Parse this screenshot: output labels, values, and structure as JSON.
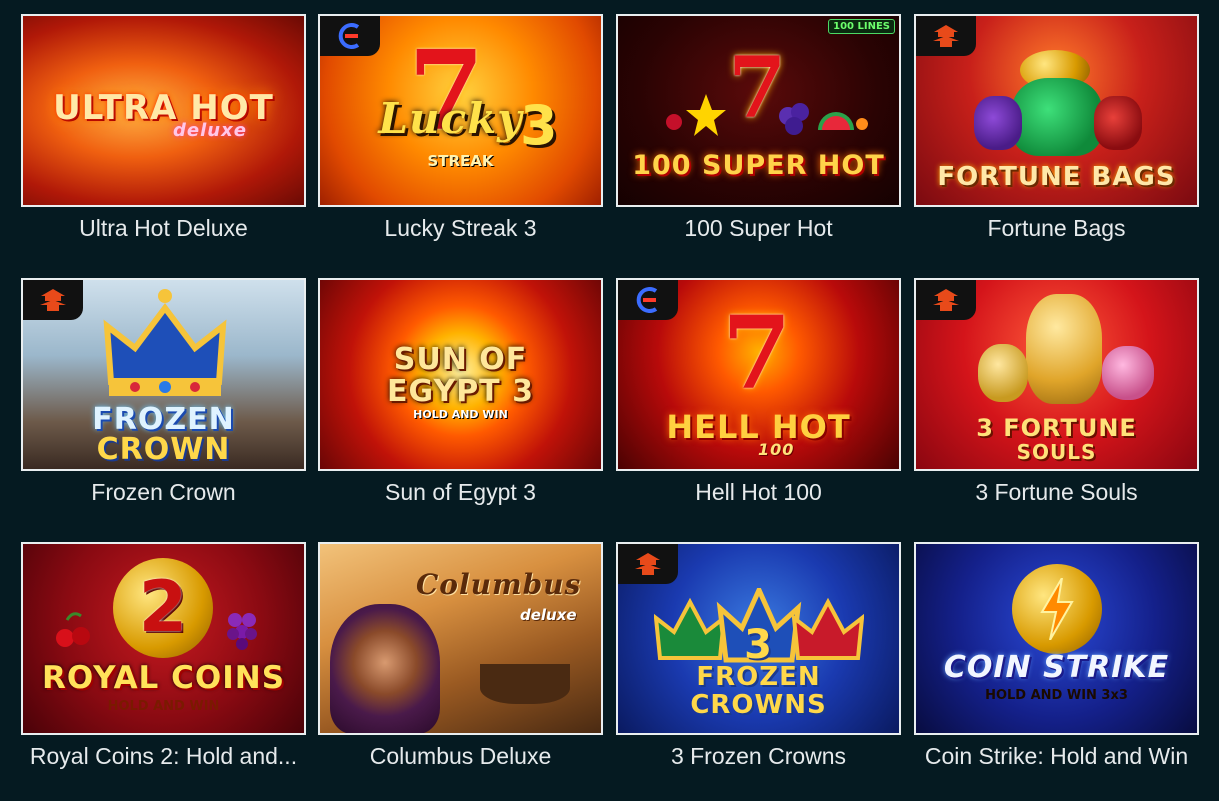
{
  "games": [
    {
      "title": "Ultra Hot Deluxe",
      "art_text": "ULTRA HOT",
      "art_sub": "deluxe"
    },
    {
      "title": "Lucky Streak 3",
      "art_text": "Lucky",
      "art_sub": "STREAK",
      "art_num": "3",
      "art_seven": "7"
    },
    {
      "title": "100 Super Hot",
      "art_text": "100 SUPER HOT",
      "art_badge": "100 LINES",
      "art_seven": "7"
    },
    {
      "title": "Fortune Bags",
      "art_text": "FORTUNE BAGS"
    },
    {
      "title": "Frozen Crown",
      "art_text": "FROZEN",
      "art_sub": "CROWN"
    },
    {
      "title": "Sun of Egypt 3",
      "art_text": "SUN OF EGYPT 3",
      "art_sub": "HOLD AND WIN"
    },
    {
      "title": "Hell Hot 100",
      "art_text": "HELL HOT",
      "art_sub": "100",
      "art_seven": "7"
    },
    {
      "title": "3 Fortune Souls",
      "art_text": "3 FORTUNE",
      "art_sub": "SOULS"
    },
    {
      "title": "Royal Coins 2: Hold and...",
      "art_text": "ROYAL COINS",
      "art_sub": "HOLD AND WIN",
      "art_num": "2"
    },
    {
      "title": "Columbus Deluxe",
      "art_text": "Columbus",
      "art_sub": "deluxe"
    },
    {
      "title": "3 Frozen Crowns",
      "art_text": "FROZEN",
      "art_sub": "CROWNS",
      "art_num": "3"
    },
    {
      "title": "Coin Strike: Hold and Win",
      "art_text": "COIN STRIKE",
      "art_sub": "HOLD AND WIN 3x3"
    }
  ],
  "colors": {
    "background": "#051a21",
    "caption": "#e6eaec",
    "tile_border": "#e9eef0"
  }
}
